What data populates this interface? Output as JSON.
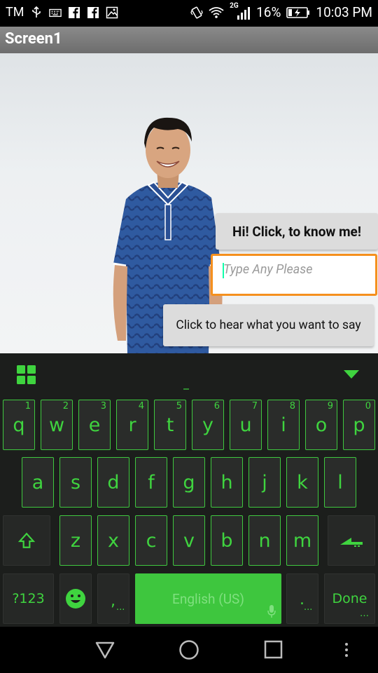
{
  "status_bar": {
    "carrier": "TM",
    "network_type": "2G",
    "battery": "16%",
    "time": "10:03 PM"
  },
  "title_bar": {
    "title": "Screen1"
  },
  "main": {
    "know_me_button": "Hi! Click, to know me!",
    "text_input": {
      "placeholder": "Type Any Please",
      "value": ""
    },
    "hear_button": "Click to hear what you want to say"
  },
  "keyboard": {
    "row1": [
      {
        "label": "q",
        "hint": "1"
      },
      {
        "label": "w",
        "hint": "2"
      },
      {
        "label": "e",
        "hint": "3"
      },
      {
        "label": "r",
        "hint": "4"
      },
      {
        "label": "t",
        "hint": "5"
      },
      {
        "label": "y",
        "hint": "6"
      },
      {
        "label": "u",
        "hint": "7"
      },
      {
        "label": "i",
        "hint": "8"
      },
      {
        "label": "o",
        "hint": "9"
      },
      {
        "label": "p",
        "hint": "0"
      }
    ],
    "row2": [
      "a",
      "s",
      "d",
      "f",
      "g",
      "h",
      "j",
      "k",
      "l"
    ],
    "row3": [
      "z",
      "x",
      "c",
      "v",
      "b",
      "n",
      "m"
    ],
    "symbols_label": "?123",
    "comma_label": ",",
    "comma_hint": "...",
    "space_label": "English (US)",
    "period_label": ".",
    "period_hint": "...",
    "done_label": "Done",
    "accent_color": "#3fd43f"
  },
  "navigation": {
    "icons": [
      "back-icon",
      "home-icon",
      "recents-icon",
      "menu-icon"
    ]
  }
}
